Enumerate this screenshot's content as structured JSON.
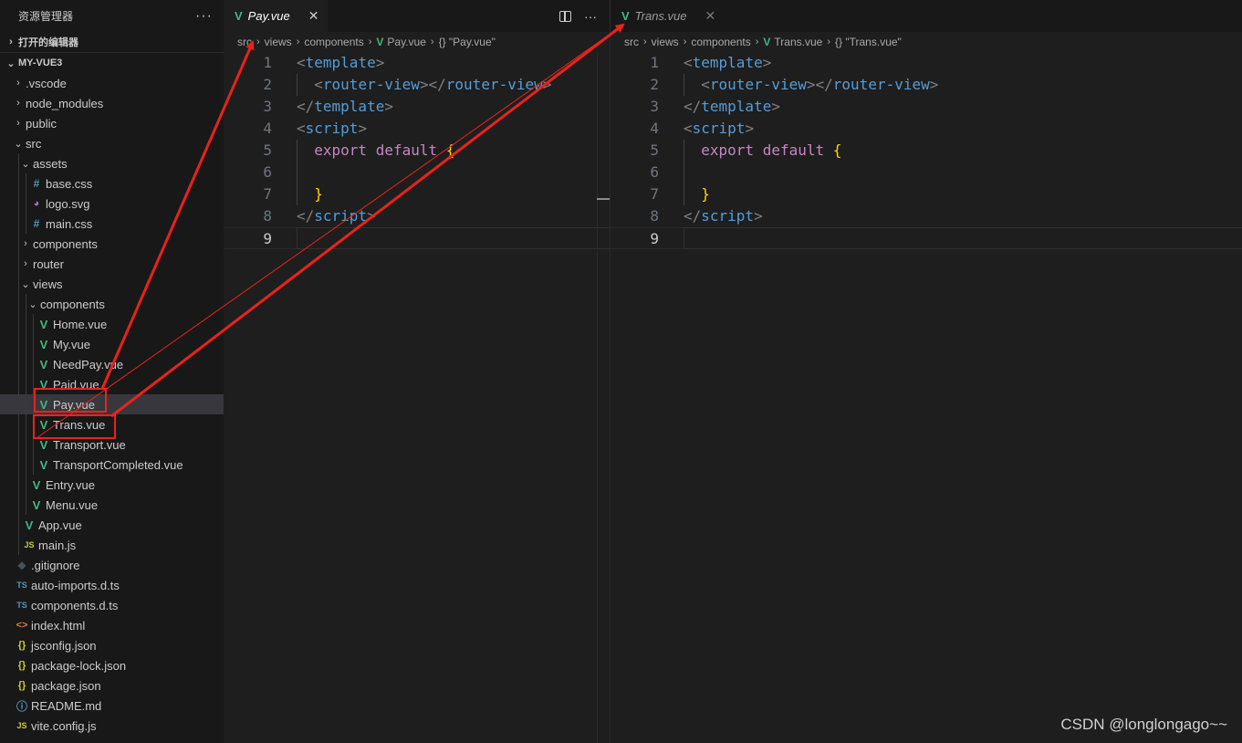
{
  "explorer": {
    "title": "资源管理器",
    "more_glyph": "···",
    "open_editors_label": "打开的编辑器",
    "project_label": "MY-VUE3",
    "items": [
      {
        "label": ".vscode",
        "depth": 1,
        "chev": "›",
        "icon": ""
      },
      {
        "label": "node_modules",
        "depth": 1,
        "chev": "›",
        "icon": ""
      },
      {
        "label": "public",
        "depth": 1,
        "chev": "›",
        "icon": ""
      },
      {
        "label": "src",
        "depth": 1,
        "chev": "⌄",
        "icon": ""
      },
      {
        "label": "assets",
        "depth": 2,
        "chev": "⌄",
        "icon": ""
      },
      {
        "label": "base.css",
        "depth": 3,
        "chev": "",
        "icon": "css"
      },
      {
        "label": "logo.svg",
        "depth": 3,
        "chev": "",
        "icon": "svg"
      },
      {
        "label": "main.css",
        "depth": 3,
        "chev": "",
        "icon": "css"
      },
      {
        "label": "components",
        "depth": 2,
        "chev": "›",
        "icon": ""
      },
      {
        "label": "router",
        "depth": 2,
        "chev": "›",
        "icon": ""
      },
      {
        "label": "views",
        "depth": 2,
        "chev": "⌄",
        "icon": ""
      },
      {
        "label": "components",
        "depth": 3,
        "chev": "⌄",
        "icon": ""
      },
      {
        "label": "Home.vue",
        "depth": 4,
        "chev": "",
        "icon": "vue"
      },
      {
        "label": "My.vue",
        "depth": 4,
        "chev": "",
        "icon": "vue"
      },
      {
        "label": "NeedPay.vue",
        "depth": 4,
        "chev": "",
        "icon": "vue"
      },
      {
        "label": "Paid.vue",
        "depth": 4,
        "chev": "",
        "icon": "vue"
      },
      {
        "label": "Pay.vue",
        "depth": 4,
        "chev": "",
        "icon": "vue",
        "selected": true
      },
      {
        "label": "Trans.vue",
        "depth": 4,
        "chev": "",
        "icon": "vue"
      },
      {
        "label": "Transport.vue",
        "depth": 4,
        "chev": "",
        "icon": "vue"
      },
      {
        "label": "TransportCompleted.vue",
        "depth": 4,
        "chev": "",
        "icon": "vue"
      },
      {
        "label": "Entry.vue",
        "depth": 3,
        "chev": "",
        "icon": "vue"
      },
      {
        "label": "Menu.vue",
        "depth": 3,
        "chev": "",
        "icon": "vue"
      },
      {
        "label": "App.vue",
        "depth": 2,
        "chev": "",
        "icon": "vue"
      },
      {
        "label": "main.js",
        "depth": 2,
        "chev": "",
        "icon": "js"
      },
      {
        "label": ".gitignore",
        "depth": 1,
        "chev": "",
        "icon": "git"
      },
      {
        "label": "auto-imports.d.ts",
        "depth": 1,
        "chev": "",
        "icon": "ts"
      },
      {
        "label": "components.d.ts",
        "depth": 1,
        "chev": "",
        "icon": "ts"
      },
      {
        "label": "index.html",
        "depth": 1,
        "chev": "",
        "icon": "html"
      },
      {
        "label": "jsconfig.json",
        "depth": 1,
        "chev": "",
        "icon": "json"
      },
      {
        "label": "package-lock.json",
        "depth": 1,
        "chev": "",
        "icon": "json"
      },
      {
        "label": "package.json",
        "depth": 1,
        "chev": "",
        "icon": "json"
      },
      {
        "label": "README.md",
        "depth": 1,
        "chev": "",
        "icon": "md"
      },
      {
        "label": "vite.config.js",
        "depth": 1,
        "chev": "",
        "icon": "js"
      }
    ]
  },
  "icon_glyphs": {
    "vue": "V",
    "css": "#",
    "svg": "◕",
    "js": "JS",
    "ts": "TS",
    "git": "◆",
    "html": "<>",
    "json": "{}",
    "md": "ⓘ"
  },
  "editors": {
    "left": {
      "tab_label": "Pay.vue",
      "close_glyph": "✕",
      "more_glyph": "···",
      "breadcrumb": [
        "src",
        "views",
        "components",
        "Pay.vue",
        "{} \"Pay.vue\""
      ],
      "current_line": 9
    },
    "right": {
      "tab_label": "Trans.vue",
      "close_glyph": "✕",
      "breadcrumb": [
        "src",
        "views",
        "components",
        "Trans.vue",
        "{} \"Trans.vue\""
      ],
      "current_line": 9
    }
  },
  "code_lines": [
    [
      {
        "t": "<",
        "c": "punct"
      },
      {
        "t": "template",
        "c": "tag"
      },
      {
        "t": ">",
        "c": "punct"
      }
    ],
    [
      {
        "t": "  ",
        "c": ""
      },
      {
        "t": "<",
        "c": "punct"
      },
      {
        "t": "router-view",
        "c": "tag"
      },
      {
        "t": "></",
        "c": "punct"
      },
      {
        "t": "router-view",
        "c": "tag"
      },
      {
        "t": ">",
        "c": "punct"
      }
    ],
    [
      {
        "t": "</",
        "c": "punct"
      },
      {
        "t": "template",
        "c": "tag"
      },
      {
        "t": ">",
        "c": "punct"
      }
    ],
    [
      {
        "t": "<",
        "c": "punct"
      },
      {
        "t": "script",
        "c": "tag"
      },
      {
        "t": ">",
        "c": "punct"
      }
    ],
    [
      {
        "t": "  ",
        "c": ""
      },
      {
        "t": "export",
        "c": "kw"
      },
      {
        "t": " ",
        "c": ""
      },
      {
        "t": "default",
        "c": "kw"
      },
      {
        "t": " ",
        "c": ""
      },
      {
        "t": "{",
        "c": "brace"
      }
    ],
    [],
    [
      {
        "t": "  ",
        "c": ""
      },
      {
        "t": "}",
        "c": "brace"
      }
    ],
    [
      {
        "t": "</",
        "c": "punct"
      },
      {
        "t": "script",
        "c": "tag"
      },
      {
        "t": ">",
        "c": "punct"
      }
    ],
    []
  ],
  "watermark": "CSDN @longlongago~~"
}
